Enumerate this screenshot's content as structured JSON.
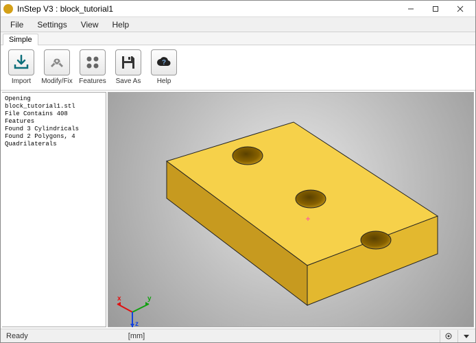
{
  "window": {
    "title": "InStep V3 : block_tutorial1"
  },
  "menus": {
    "file": "File",
    "settings": "Settings",
    "view": "View",
    "help": "Help"
  },
  "tabs": {
    "simple": "Simple"
  },
  "toolbar": {
    "import": "Import",
    "modifyfix": "Modify/Fix",
    "features": "Features",
    "saveas": "Save As",
    "help": "Help"
  },
  "log": {
    "l1": "Opening",
    "l2": "block_tutorial1.stl",
    "l3": "File Contains 408",
    "l4": "Features",
    "l5": "Found 3 Cylindricals",
    "l6": "Found 2 Polygons, 4",
    "l7": "Quadrilaterals"
  },
  "axes": {
    "x": "x",
    "y": "y",
    "z": "z"
  },
  "status": {
    "ready": "Ready",
    "units": "[mm]"
  },
  "colors": {
    "block_top": "#f6d14a",
    "block_front": "#c79a1f",
    "block_side": "#e3b82f"
  }
}
